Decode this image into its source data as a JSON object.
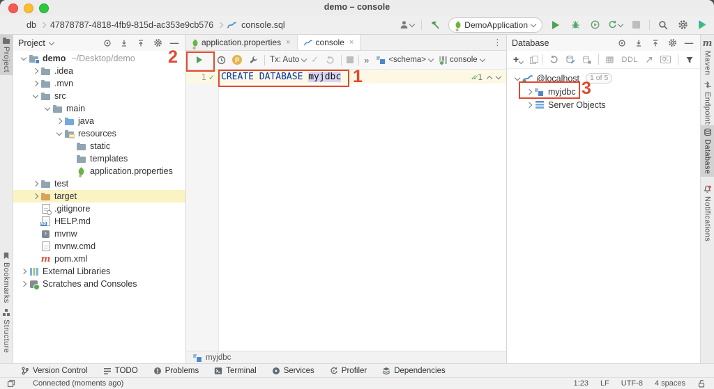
{
  "window": {
    "title": "demo – console"
  },
  "breadcrumb": {
    "root": "db",
    "datasource": "47878787-4818-4fb9-815d-ac353e9cb576",
    "file": "console.sql"
  },
  "navbar": {
    "run_config": "DemoApplication"
  },
  "tabs": {
    "properties": "application.properties",
    "console": "console",
    "close": "×",
    "more": "⋮"
  },
  "editor_toolbar": {
    "tx": "Tx: Auto",
    "commit": "✓",
    "more": "»",
    "schema": "<schema>",
    "session": "console"
  },
  "editor": {
    "line_number": "1",
    "keyword": "CREATE DATABASE",
    "identifier": "myjdbc",
    "inspections": "1",
    "check": "✓",
    "dblcheck": "✓✓"
  },
  "editor_footer": {
    "schema": "myjdbc"
  },
  "project": {
    "title": "Project",
    "tree": [
      {
        "label": "demo",
        "sub": "~/Desktop/demo"
      },
      {
        "label": ".idea"
      },
      {
        "label": ".mvn"
      },
      {
        "label": "src"
      },
      {
        "label": "main"
      },
      {
        "label": "java"
      },
      {
        "label": "resources"
      },
      {
        "label": "static"
      },
      {
        "label": "templates"
      },
      {
        "label": "application.properties"
      },
      {
        "label": "test"
      },
      {
        "label": "target"
      },
      {
        "label": ".gitignore"
      },
      {
        "label": "HELP.md"
      },
      {
        "label": "mvnw"
      },
      {
        "label": "mvnw.cmd"
      },
      {
        "label": "pom.xml"
      },
      {
        "label": "External Libraries"
      },
      {
        "label": "Scratches and Consoles"
      }
    ]
  },
  "database": {
    "title": "Database",
    "ddl": "DDL",
    "ql": "QL",
    "host": "@localhost",
    "badge": "1 of 5",
    "schema": "myjdbc",
    "server_objects": "Server Objects"
  },
  "left_strip": {
    "project": "Project",
    "bookmarks": "Bookmarks",
    "structure": "Structure"
  },
  "right_strip": {
    "maven": "Maven",
    "maven_icon": "m",
    "endpoints": "Endpoints",
    "database": "Database",
    "notifications": "Notifications"
  },
  "bottom_bar": {
    "vcs": "Version Control",
    "todo": "TODO",
    "problems": "Problems",
    "terminal": "Terminal",
    "services": "Services",
    "profiler": "Profiler",
    "dependencies": "Dependencies"
  },
  "status_bar": {
    "message": "Connected (moments ago)",
    "position": "1:23",
    "line_separator": "LF",
    "encoding": "UTF-8",
    "indent": "4 spaces"
  },
  "annotations": {
    "step1": "1",
    "step2": "2",
    "step3": "3"
  },
  "colors": {
    "annotation_red": "#e1492f",
    "keyword_blue": "#0033b3",
    "spring_green": "#6db33f",
    "run_green": "#4ea24e",
    "selection_lavender": "#d8d5f2",
    "current_line": "#fcf8e3",
    "selected_row": "#fbf3c4",
    "mysql_blue": "#4e8ac8"
  }
}
